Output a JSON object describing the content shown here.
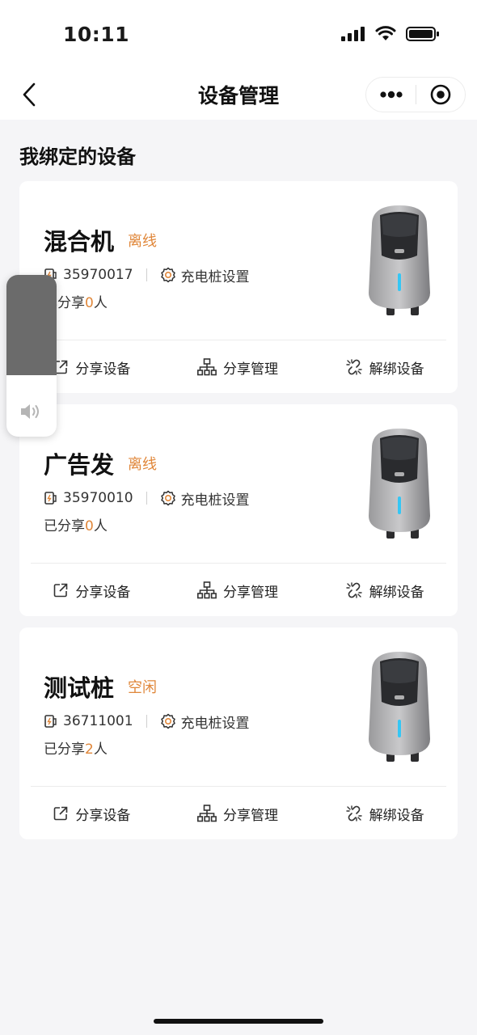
{
  "status_bar": {
    "time": "10:11"
  },
  "nav": {
    "title": "设备管理"
  },
  "section_title": "我绑定的设备",
  "devices": [
    {
      "name": "混合机",
      "status": "离线",
      "id": "35970017",
      "settings_label": "充电桩设置",
      "share_prefix": "已分享",
      "share_count": "0",
      "share_suffix": "人"
    },
    {
      "name": "广告发",
      "status": "离线",
      "id": "35970010",
      "settings_label": "充电桩设置",
      "share_prefix": "已分享",
      "share_count": "0",
      "share_suffix": "人"
    },
    {
      "name": "测试桩",
      "status": "空闲",
      "id": "36711001",
      "settings_label": "充电桩设置",
      "share_prefix": "已分享",
      "share_count": "2",
      "share_suffix": "人"
    }
  ],
  "actions": {
    "share_device": "分享设备",
    "share_manage": "分享管理",
    "unbind_device": "解绑设备"
  },
  "volume_overlay": {
    "level": 0.62
  },
  "colors": {
    "accent": "#e0873a",
    "background": "#f5f5f7"
  }
}
